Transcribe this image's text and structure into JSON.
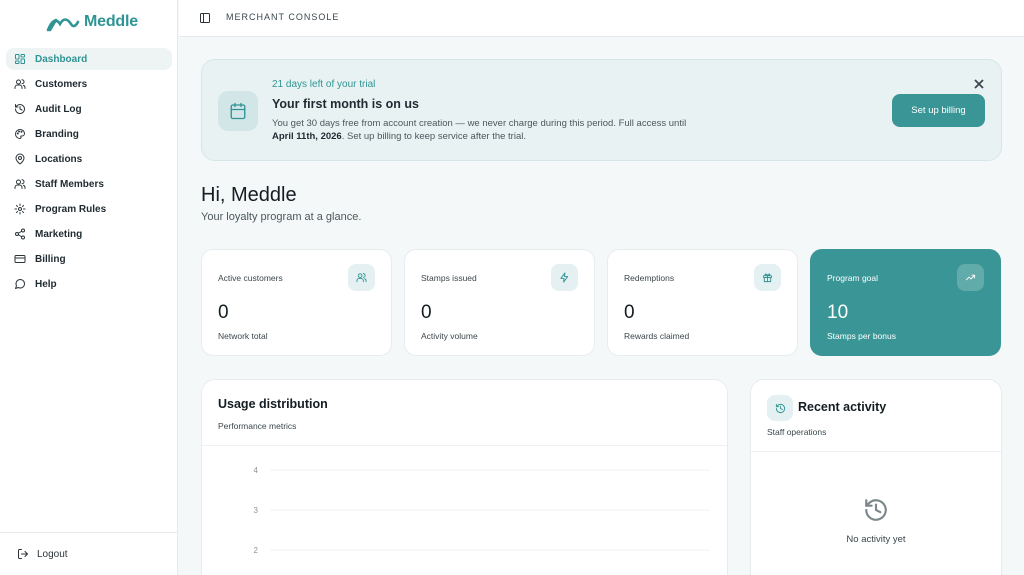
{
  "app": {
    "name": "Meddle",
    "brand_color": "#2f9493",
    "console_title": "MERCHANT CONSOLE"
  },
  "sidebar": {
    "items": [
      {
        "label": "Dashboard",
        "icon": "dashboard-icon",
        "active": true
      },
      {
        "label": "Customers",
        "icon": "users-icon"
      },
      {
        "label": "Audit Log",
        "icon": "history-icon"
      },
      {
        "label": "Branding",
        "icon": "palette-icon"
      },
      {
        "label": "Locations",
        "icon": "map-pin-icon"
      },
      {
        "label": "Staff Members",
        "icon": "users-icon"
      },
      {
        "label": "Program Rules",
        "icon": "gear-icon"
      },
      {
        "label": "Marketing",
        "icon": "share-icon"
      },
      {
        "label": "Billing",
        "icon": "credit-card-icon"
      },
      {
        "label": "Help",
        "icon": "message-circle-icon"
      }
    ],
    "logout_label": "Logout"
  },
  "banner": {
    "eyebrow": "21 days left of your trial",
    "title": "Your first month is on us",
    "body_prefix": "You get 30 days free from account creation — we never charge during this period. Full access until ",
    "body_date": "April 11th, 2026",
    "body_suffix": ". Set up billing to keep service after the trial.",
    "button_label": "Set up billing"
  },
  "greeting": {
    "title": "Hi, Meddle",
    "subtitle": "Your loyalty program at a glance."
  },
  "stats": [
    {
      "label": "Active customers",
      "value": "0",
      "sub": "Network total",
      "icon": "users-icon"
    },
    {
      "label": "Stamps issued",
      "value": "0",
      "sub": "Activity volume",
      "icon": "zap-icon"
    },
    {
      "label": "Redemptions",
      "value": "0",
      "sub": "Rewards claimed",
      "icon": "gift-icon"
    },
    {
      "label": "Program goal",
      "value": "10",
      "sub": "Stamps per bonus",
      "icon": "trending-up-icon",
      "accent": true
    }
  ],
  "usage": {
    "title": "Usage distribution",
    "subtitle": "Performance metrics"
  },
  "chart_data": {
    "type": "bar",
    "title": "Usage distribution",
    "y_ticks": [
      "4",
      "3",
      "2"
    ],
    "grid": true,
    "series": []
  },
  "activity": {
    "title": "Recent activity",
    "subtitle": "Staff operations",
    "empty_text": "No activity yet"
  }
}
